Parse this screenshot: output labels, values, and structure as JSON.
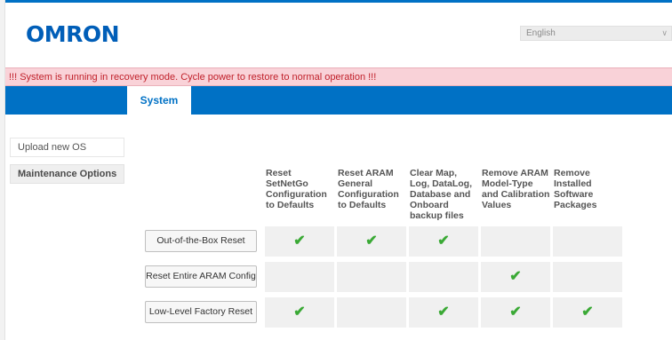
{
  "header": {
    "logo": "omron",
    "language": {
      "selected": "English",
      "icon": "chevron-down-icon"
    }
  },
  "banner": {
    "text": "!!! System is running in recovery mode. Cycle power to restore to normal operation !!!",
    "color": "#c0202a",
    "background": "#f9d2d8"
  },
  "nav": {
    "tabs": [
      {
        "label": "System",
        "active": true
      }
    ],
    "color": "#0071c5"
  },
  "sidebar": {
    "items": [
      {
        "label": "Upload new OS"
      },
      {
        "label": "Maintenance Options",
        "active": true
      }
    ]
  },
  "table": {
    "columns": [
      "Reset SetNetGo Configuration to Defaults",
      "Reset ARAM General Configuration to Defaults",
      "Clear Map, Log, DataLog, Database and Onboard backup files",
      "Remove ARAM Model-Type and Calibration Values",
      "Remove Installed Software Packages"
    ],
    "check_symbol": "✔",
    "check_color": "#3aa935",
    "rows": [
      {
        "action": "Out-of-the-Box Reset",
        "checks": [
          true,
          true,
          true,
          false,
          false
        ]
      },
      {
        "action": "Reset Entire ARAM Config",
        "checks": [
          false,
          false,
          false,
          true,
          false
        ]
      },
      {
        "action": "Low-Level Factory Reset",
        "checks": [
          true,
          false,
          true,
          true,
          true
        ]
      }
    ]
  }
}
